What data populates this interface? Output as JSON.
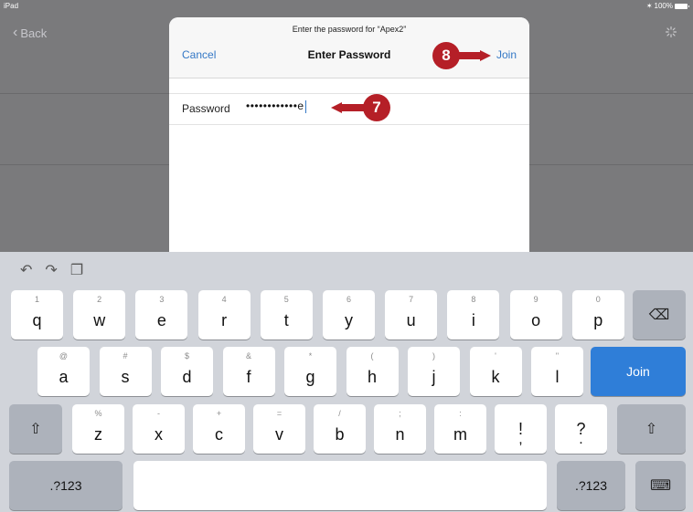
{
  "status": {
    "device": "iPad",
    "battery": "100%"
  },
  "back": {
    "label": "Back"
  },
  "dialog": {
    "prompt": "Enter the password for “Apex2”",
    "cancel": "Cancel",
    "title": "Enter Password",
    "join": "Join",
    "password_label": "Password",
    "password_value": "••••••••••••e"
  },
  "callouts": {
    "step7": "7",
    "step8": "8"
  },
  "keyboard": {
    "shortcuts": [
      "undo-icon",
      "redo-icon",
      "paste-icon"
    ],
    "row1": [
      {
        "main": "q",
        "alt": "1"
      },
      {
        "main": "w",
        "alt": "2"
      },
      {
        "main": "e",
        "alt": "3"
      },
      {
        "main": "r",
        "alt": "4"
      },
      {
        "main": "t",
        "alt": "5"
      },
      {
        "main": "y",
        "alt": "6"
      },
      {
        "main": "u",
        "alt": "7"
      },
      {
        "main": "i",
        "alt": "8"
      },
      {
        "main": "o",
        "alt": "9"
      },
      {
        "main": "p",
        "alt": "0"
      }
    ],
    "row2": [
      {
        "main": "a",
        "alt": "@"
      },
      {
        "main": "s",
        "alt": "#"
      },
      {
        "main": "d",
        "alt": "$"
      },
      {
        "main": "f",
        "alt": "&"
      },
      {
        "main": "g",
        "alt": "*"
      },
      {
        "main": "h",
        "alt": "("
      },
      {
        "main": "j",
        "alt": ")"
      },
      {
        "main": "k",
        "alt": "'"
      },
      {
        "main": "l",
        "alt": "\""
      }
    ],
    "row3": [
      {
        "main": "z",
        "alt": "%"
      },
      {
        "main": "x",
        "alt": "-"
      },
      {
        "main": "c",
        "alt": "+"
      },
      {
        "main": "v",
        "alt": "="
      },
      {
        "main": "b",
        "alt": "/"
      },
      {
        "main": "n",
        "alt": ";"
      },
      {
        "main": "m",
        "alt": ":"
      },
      {
        "main": "!",
        "alt": ""
      },
      {
        "main": "?",
        "alt": ""
      }
    ],
    "row3_under": [
      "",
      "",
      "",
      "",
      "",
      "",
      "",
      ",",
      "."
    ],
    "join": "Join",
    "numbers_left": ".?123",
    "numbers_right": ".?123",
    "colors": {
      "accent": "#3478c6",
      "callout": "#b51f27",
      "join_key": "#2f7ed8"
    }
  }
}
